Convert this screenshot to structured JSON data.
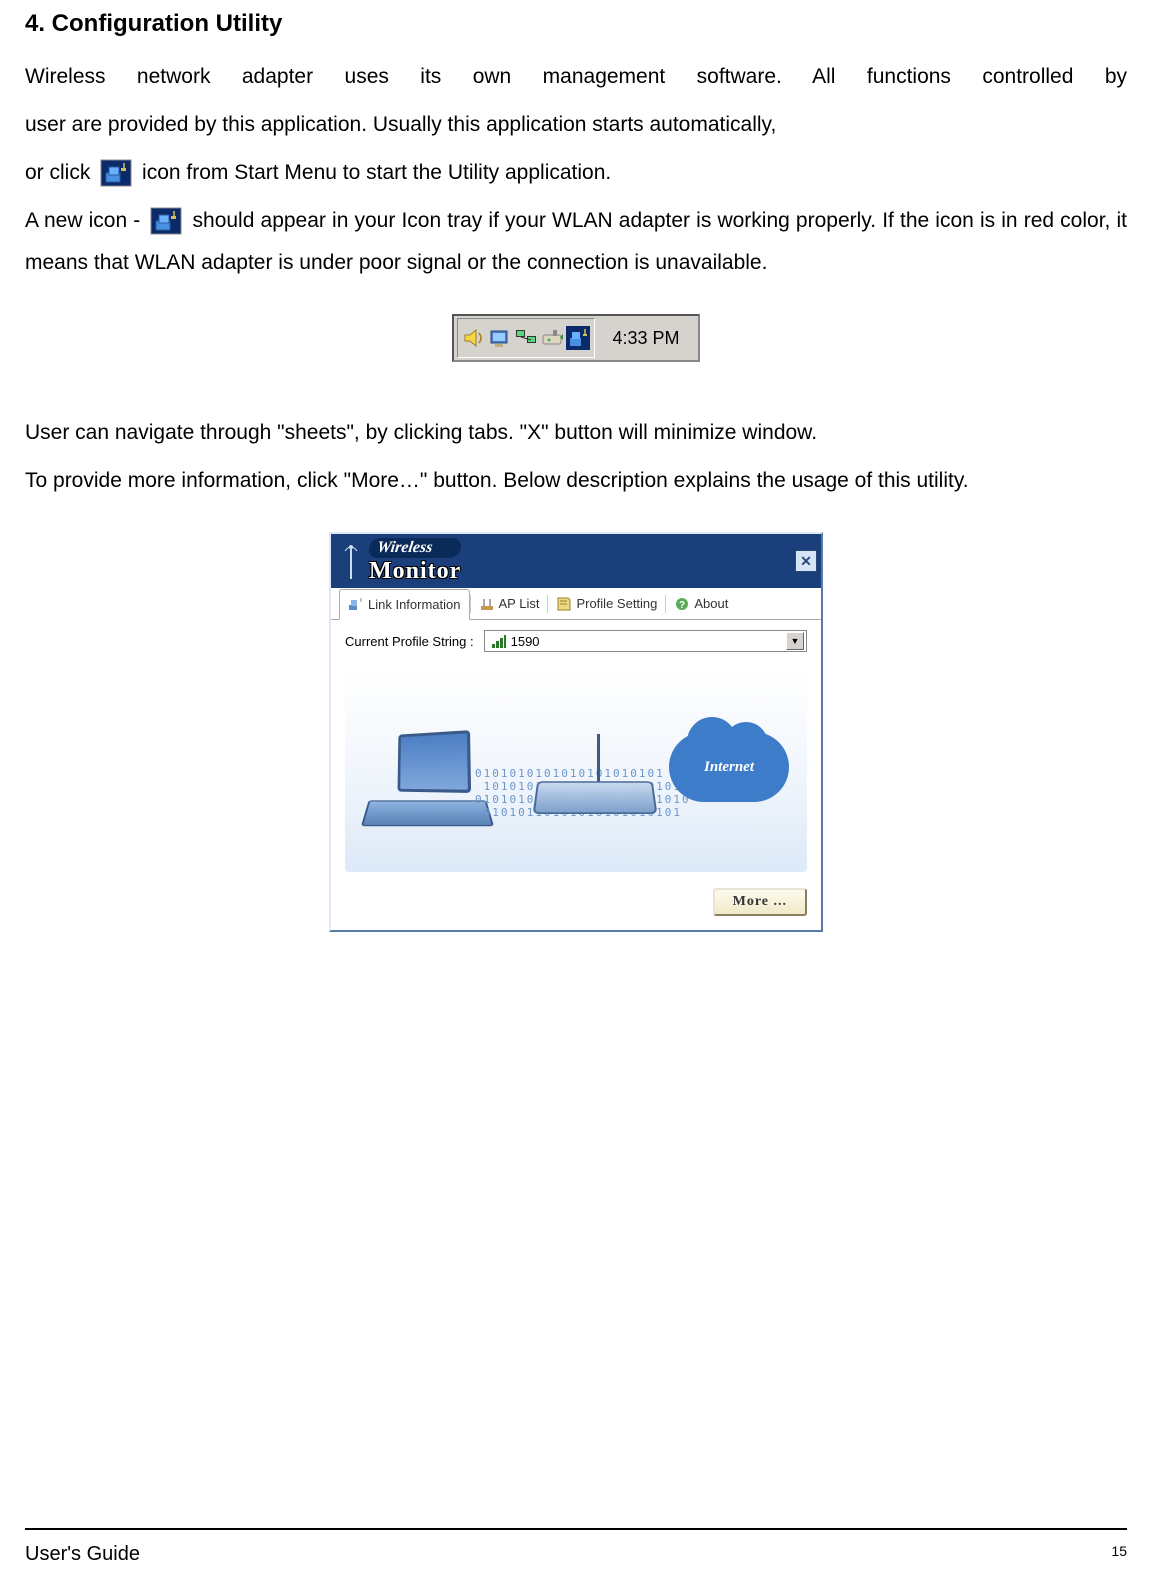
{
  "heading": "4. Configuration Utility",
  "para1a": "Wireless  network  adapter  uses  its  own  management  software.  All  functions  controlled  by",
  "para1b": "user   are provided by this application. Usually this application starts automatically,",
  "para2_a": "or click  ",
  "para2_b": "  icon from Start Menu to start the Utility application.",
  "para3_a": "A new icon - ",
  "para3_b": " should appear in your Icon tray if your WLAN adapter is working properly. If the icon is in red color, it means that WLAN adapter is under poor signal or the connection is unavailable.",
  "systray": {
    "time": "4:33 PM"
  },
  "para4": "User can navigate through \"sheets\", by clicking tabs.    \"X\" button will minimize window.",
  "para5": "To provide more information, click \"More…\" button. Below description explains the usage of this utility.",
  "monitor": {
    "title_small": "Wireless",
    "title_big": "Monitor",
    "tabs": {
      "link": "Link Information",
      "ap": "AP List",
      "profile": "Profile Setting",
      "about": "About"
    },
    "profile_label": "Current Profile String :",
    "profile_value": "1590",
    "cloud_label": "Internet",
    "binary": "0101010101010101010101\n 10101010101010101010101\n0101010101010101010101010\n 01010110101010101010101",
    "more_label": "More ..."
  },
  "footer": {
    "guide": "User's Guide",
    "page": "15"
  }
}
